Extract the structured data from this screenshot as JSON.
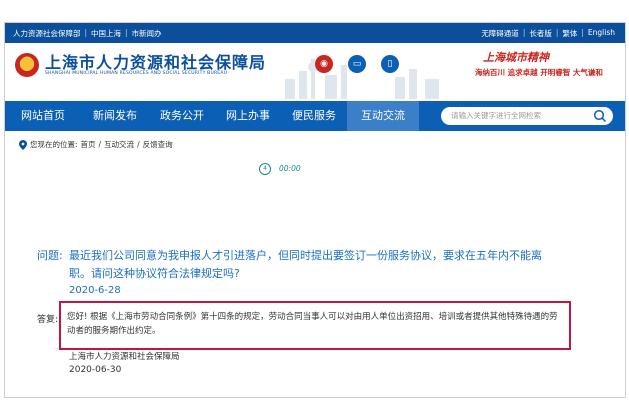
{
  "topbar": {
    "left_links": [
      "人力资源社会保障部",
      "中国上海",
      "市新闻办"
    ],
    "right_links": [
      "无障碍通道",
      "长者版",
      "繁体",
      "English"
    ]
  },
  "header": {
    "title": "上海市人力资源和社会保障局",
    "subtitle": "SHANGHAI MUNICIPAL HUMAN RESOURCES AND SOCIAL SECURITY BUREAU",
    "slogan_title": "上海城市精神",
    "slogan": "海纳百川  追求卓越  开明睿智  大气谦和"
  },
  "nav": {
    "items": [
      "网站首页",
      "新闻发布",
      "政务公开",
      "网上办事",
      "便民服务",
      "互动交流"
    ],
    "active_index": 5,
    "search_placeholder": "请输入关键字进行全网检索"
  },
  "breadcrumb": {
    "label": "您现在的位置:",
    "items": [
      "首页",
      "互动交流",
      "反馈查询"
    ],
    "separator": "/"
  },
  "audio": {
    "play_symbol": "4",
    "time": "00:00"
  },
  "question": {
    "label": "问题:",
    "text": "最近我们公司同意为我申报人才引进落户，但同时提出要签订一份服务协议，要求在五年内不能离职。请问这种协议符合法律规定吗?",
    "date": "2020-6-28"
  },
  "answer": {
    "label": "答复:",
    "text": "您好! 根据《上海市劳动合同条例》第十四条的规定，劳动合同当事人可以对由用人单位出资招用、培训或者提供其他特殊待遇的劳动者的服务期作出约定。",
    "org": "上海市人力资源和社会保障局",
    "date": "2020-06-30"
  }
}
